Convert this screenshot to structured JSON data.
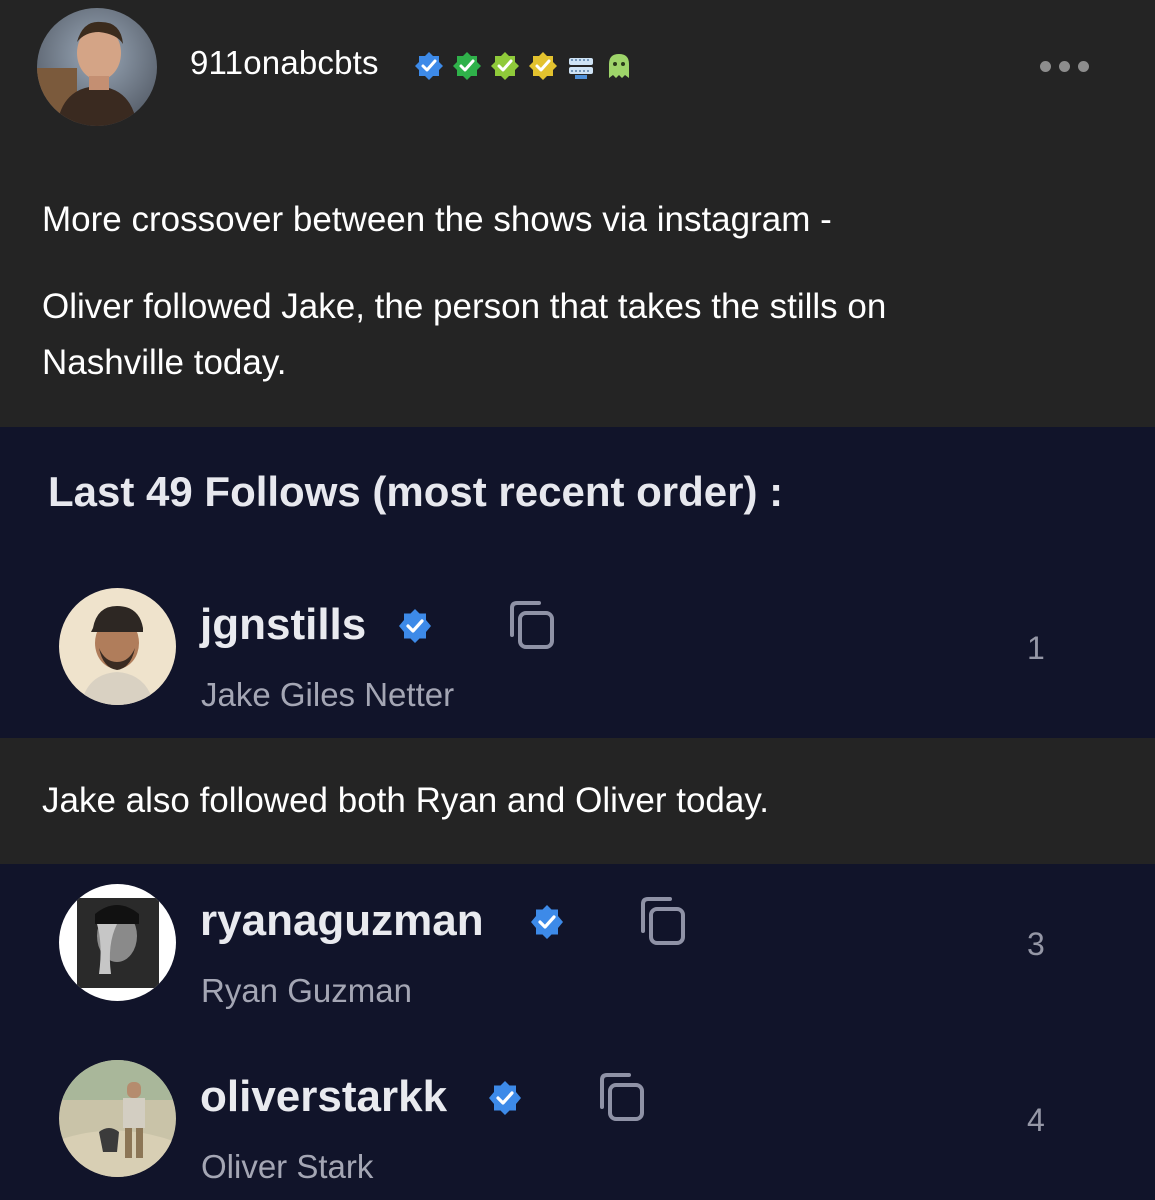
{
  "post": {
    "username": "911onabcbts",
    "badges": [
      "verified-blue-badge",
      "verified-green-badge",
      "verified-lime-badge",
      "verified-yellow-badge",
      "teeth-badge",
      "ghost-badge"
    ],
    "paragraphs": [
      "More crossover between the shows via instagram -",
      "Oliver followed Jake, the person that takes the stills on",
      "Nashville today."
    ],
    "between_text": "Jake also followed both Ryan and Oliver today."
  },
  "follows_panel": {
    "heading": "Last 49 Follows (most recent order) :",
    "accounts": [
      {
        "handle": "jgnstills",
        "name": "Jake Giles Netter",
        "rank": "1"
      },
      {
        "handle": "ryanaguzman",
        "name": "Ryan Guzman",
        "rank": "3"
      },
      {
        "handle": "oliverstarkk",
        "name": "Oliver Stark",
        "rank": "4"
      }
    ]
  },
  "colors": {
    "background": "#242424",
    "panel": "#11142a",
    "verified_blue": "#3d8ae8",
    "muted_text": "#a4a6b4"
  }
}
